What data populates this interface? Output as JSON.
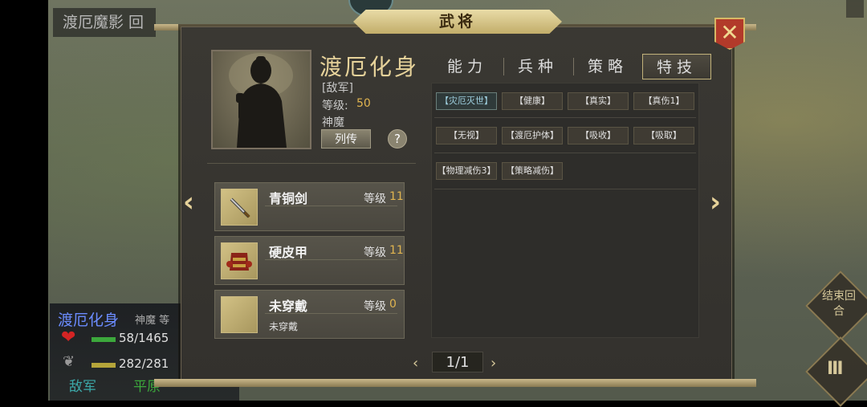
{
  "background": {
    "title": "渡厄魔影 回",
    "unit_card": {
      "name": "渡厄化身",
      "race": "神魔 等",
      "hp": "58/1465",
      "mp": "282/281",
      "faction": "敌军",
      "terrain": "平原"
    },
    "end_turn_label": "结束回合",
    "menu_label": "III"
  },
  "dialog": {
    "title": "武将",
    "close_icon": "close-x-icon"
  },
  "general": {
    "name": "渡厄化身",
    "faction": "[敌军]",
    "level_label": "等级:",
    "level_value": "50",
    "race": "神魔",
    "biography_button": "列传",
    "help_button": "?"
  },
  "equipment": [
    {
      "name": "青铜剑",
      "level_label": "等级",
      "level_value": "11",
      "icon": "sword-icon",
      "sub": ""
    },
    {
      "name": "硬皮甲",
      "level_label": "等级",
      "level_value": "11",
      "icon": "armor-icon",
      "sub": ""
    },
    {
      "name": "未穿戴",
      "level_label": "等级",
      "level_value": "0",
      "icon": "empty-slot-icon",
      "sub": "未穿戴"
    }
  ],
  "tabs": [
    {
      "label": "能力",
      "active": false
    },
    {
      "label": "兵种",
      "active": false
    },
    {
      "label": "策略",
      "active": false
    },
    {
      "label": "特技",
      "active": true
    }
  ],
  "skills": [
    [
      "【灾厄灭世】",
      "【健康】",
      "【真实】",
      "【真伤1】"
    ],
    [
      "【无视】",
      "【渡厄护体】",
      "【吸收】",
      "【吸取】"
    ],
    [
      "【物理减伤3】",
      "【策略减伤】"
    ]
  ],
  "pager": {
    "prev": "‹",
    "next": "›",
    "text": "1/1"
  },
  "nav": {
    "left": "‹",
    "right": "›"
  },
  "colors": {
    "accent_gold": "#e6d29a",
    "level_gold": "#e0b450",
    "close_red": "#b23a2a"
  }
}
